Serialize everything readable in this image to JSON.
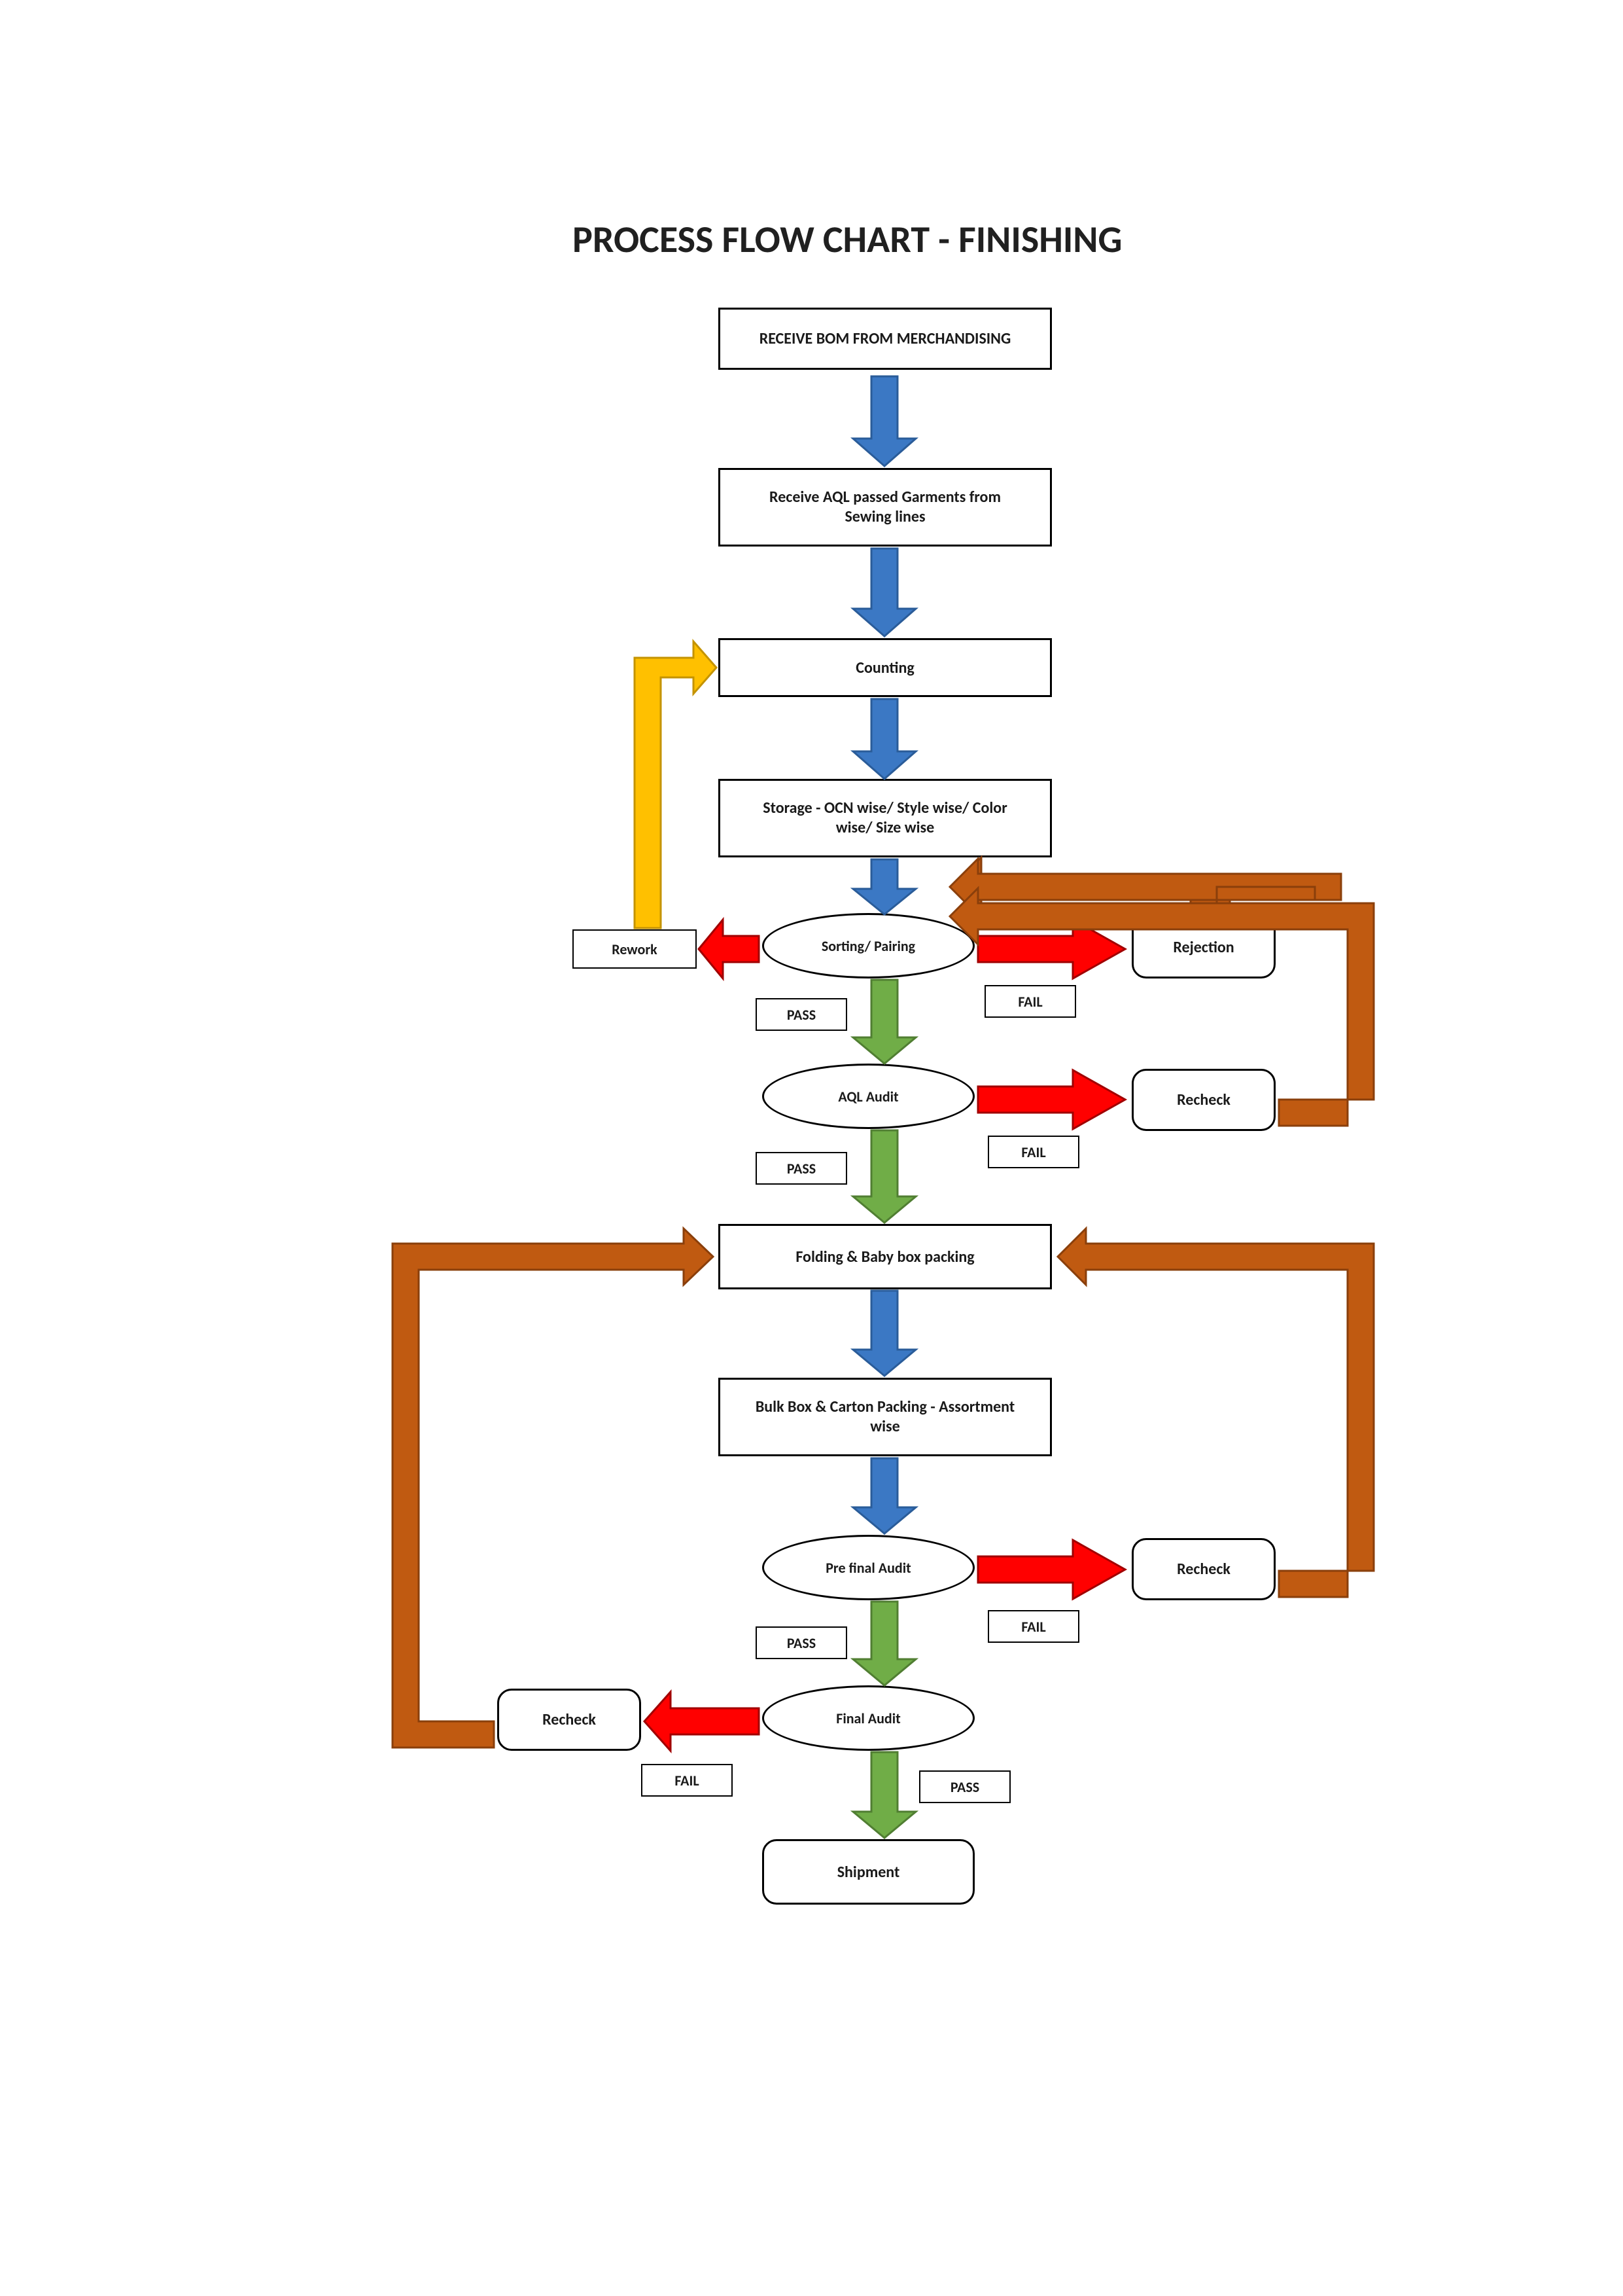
{
  "title": "PROCESS FLOW CHART - FINISHING",
  "nodes": {
    "n1": "RECEIVE BOM FROM MERCHANDISING",
    "n2_line1": "Receive AQL passed Garments from",
    "n2_line2": "Sewing lines",
    "n3": "Counting",
    "n4_line1": "Storage - OCN wise/ Style wise/ Color",
    "n4_line2": "wise/ Size wise",
    "n5": "Sorting/ Pairing",
    "n6": "AQL Audit",
    "n7": "Folding & Baby box packing",
    "n8_line1": "Bulk Box & Carton Packing - Assortment",
    "n8_line2": "wise",
    "n9": "Pre final Audit",
    "n10": "Final Audit",
    "n11": "Shipment"
  },
  "side": {
    "rework": "Rework",
    "rejection": "Rejection",
    "recheck1": "Recheck",
    "recheck2": "Recheck",
    "recheck3": "Recheck"
  },
  "labels": {
    "pass1": "PASS",
    "fail1": "FAIL",
    "pass2": "PASS",
    "fail2": "FAIL",
    "pass3": "PASS",
    "fail3": "FAIL",
    "pass4": "PASS",
    "fail4": "FAIL"
  },
  "colors": {
    "blue_fill": "#3b78c4",
    "blue_stroke": "#2a5c99",
    "green_fill": "#70ad47",
    "green_stroke": "#507e32",
    "red_fill": "#ff0000",
    "red_stroke": "#a10000",
    "orange_fill": "#c05a11",
    "orange_stroke": "#8a3f0b",
    "yellow_fill": "#ffc000",
    "yellow_stroke": "#c49300"
  }
}
